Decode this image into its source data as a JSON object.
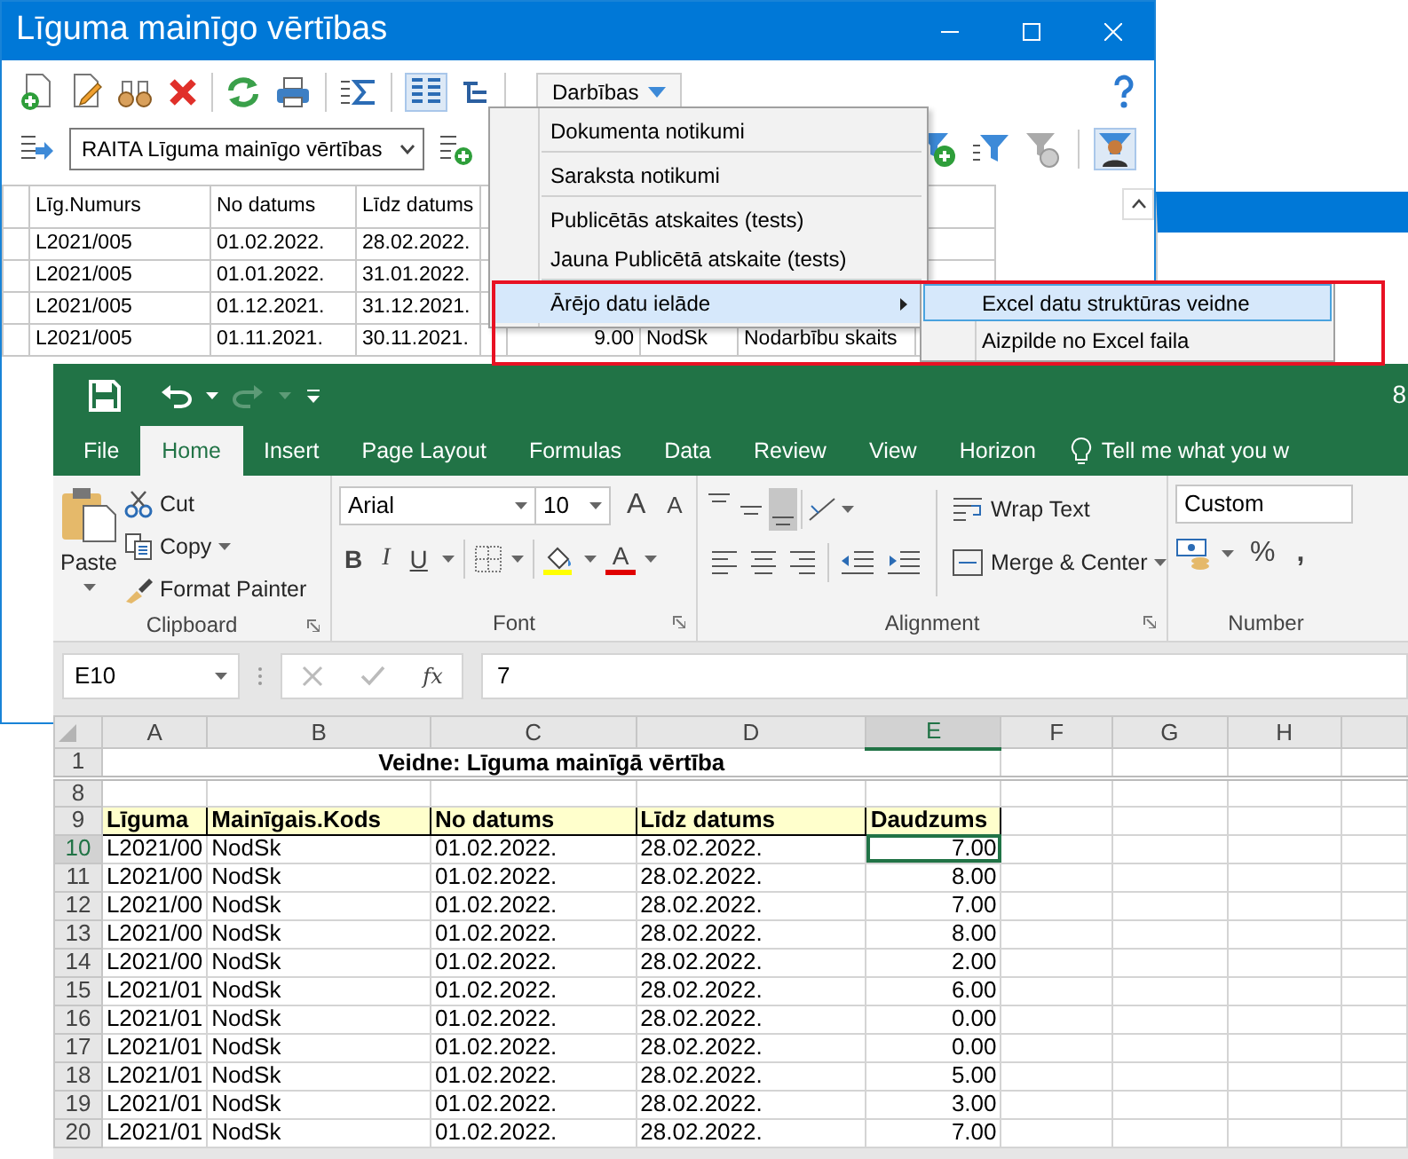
{
  "back_window": {
    "title": "Līguma mainīgo vērtības",
    "toolbar": {
      "actions_button": "Darbības",
      "columns_toggle_on": true
    },
    "view_selector": {
      "value": "RAITA Līguma mainīgo vērtības"
    },
    "grid": {
      "columns": [
        "Līg.Numurs",
        "No datums",
        "Līdz datums"
      ],
      "rows": [
        {
          "cells": [
            "L2021/005",
            "01.02.2022.",
            "28.02.2022."
          ]
        },
        {
          "cells": [
            "L2021/005",
            "01.01.2022.",
            "31.01.2022."
          ]
        },
        {
          "cells": [
            "L2021/005",
            "01.12.2021.",
            "31.12.2021."
          ]
        },
        {
          "cells": [
            "L2021/005",
            "01.11.2021.",
            "30.11.2021.",
            "9.00",
            "NodSk",
            "Nodarbību skaits"
          ]
        }
      ]
    }
  },
  "actions_menu": {
    "items": [
      {
        "label": "Dokumenta notikumi",
        "selected": false,
        "submenu": false,
        "separator_after": true
      },
      {
        "label": "Saraksta notikumi",
        "selected": false,
        "submenu": false,
        "separator_after": true
      },
      {
        "label": "Publicētās atskaites (tests)",
        "selected": false,
        "submenu": false,
        "separator_after": false
      },
      {
        "label": "Jauna Publicētā atskaite (tests)",
        "selected": false,
        "submenu": false,
        "separator_after": true
      },
      {
        "label": "Ārējo datu ielāde",
        "selected": true,
        "submenu": true,
        "separator_after": false
      }
    ],
    "submenu": [
      {
        "label": "Excel datu struktūras veidne",
        "selected": true
      },
      {
        "label": "Aizpilde no Excel faila",
        "selected": false
      }
    ]
  },
  "excel": {
    "title_fragment": "8",
    "tabs": [
      {
        "label": "File",
        "selected": false
      },
      {
        "label": "Home",
        "selected": true
      },
      {
        "label": "Insert",
        "selected": false
      },
      {
        "label": "Page Layout",
        "selected": false
      },
      {
        "label": "Formulas",
        "selected": false
      },
      {
        "label": "Data",
        "selected": false
      },
      {
        "label": "Review",
        "selected": false
      },
      {
        "label": "View",
        "selected": false
      },
      {
        "label": "Horizon",
        "selected": false
      }
    ],
    "tell_me": "Tell me what you w",
    "clipboard": {
      "paste": "Paste",
      "cut": "Cut",
      "copy": "Copy",
      "format_painter": "Format Painter",
      "label": "Clipboard"
    },
    "font": {
      "name": "Arial",
      "size": "10",
      "grow": "A",
      "shrink": "A",
      "bold": "B",
      "italic": "I",
      "underline": "U",
      "color_button": "A",
      "label": "Font"
    },
    "alignment": {
      "vertical": [
        {
          "selected": false
        },
        {
          "selected": false
        },
        {
          "selected": true
        }
      ],
      "wrap": "Wrap Text",
      "merge": "Merge & Center",
      "label": "Alignment"
    },
    "number": {
      "format": "Custom",
      "percent": "%",
      "comma": ",",
      "label": "Number"
    },
    "name_box": "E10",
    "fx": "fx",
    "formula": "7",
    "columns": [
      {
        "label": "A",
        "selected": false
      },
      {
        "label": "B",
        "selected": false
      },
      {
        "label": "C",
        "selected": false
      },
      {
        "label": "D",
        "selected": false
      },
      {
        "label": "E",
        "selected": true
      },
      {
        "label": "F",
        "selected": false
      },
      {
        "label": "G",
        "selected": false
      },
      {
        "label": "H",
        "selected": false
      }
    ],
    "rows": [
      {
        "header": "1",
        "selected": false,
        "kind": "title",
        "cells": [
          "Veidne: Līguma mainīgā vērtība"
        ]
      },
      {
        "header": "8",
        "selected": false,
        "kind": "blank"
      },
      {
        "header": "9",
        "selected": false,
        "kind": "head",
        "cells": [
          "Līguma",
          "Mainīgais.Kods",
          "No datums",
          "Līdz datums",
          "Daudzums"
        ]
      },
      {
        "header": "10",
        "selected": true,
        "kind": "data",
        "cells": [
          "L2021/00",
          "NodSk",
          "01.02.2022.",
          "28.02.2022.",
          "7.00"
        ]
      },
      {
        "header": "11",
        "selected": false,
        "kind": "data",
        "cells": [
          "L2021/00",
          "NodSk",
          "01.02.2022.",
          "28.02.2022.",
          "8.00"
        ]
      },
      {
        "header": "12",
        "selected": false,
        "kind": "data",
        "cells": [
          "L2021/00",
          "NodSk",
          "01.02.2022.",
          "28.02.2022.",
          "7.00"
        ]
      },
      {
        "header": "13",
        "selected": false,
        "kind": "data",
        "cells": [
          "L2021/00",
          "NodSk",
          "01.02.2022.",
          "28.02.2022.",
          "8.00"
        ]
      },
      {
        "header": "14",
        "selected": false,
        "kind": "data",
        "cells": [
          "L2021/00",
          "NodSk",
          "01.02.2022.",
          "28.02.2022.",
          "2.00"
        ]
      },
      {
        "header": "15",
        "selected": false,
        "kind": "data",
        "cells": [
          "L2021/01",
          "NodSk",
          "01.02.2022.",
          "28.02.2022.",
          "6.00"
        ]
      },
      {
        "header": "16",
        "selected": false,
        "kind": "data",
        "cells": [
          "L2021/01",
          "NodSk",
          "01.02.2022.",
          "28.02.2022.",
          "0.00"
        ]
      },
      {
        "header": "17",
        "selected": false,
        "kind": "data",
        "cells": [
          "L2021/01",
          "NodSk",
          "01.02.2022.",
          "28.02.2022.",
          "0.00"
        ]
      },
      {
        "header": "18",
        "selected": false,
        "kind": "data",
        "cells": [
          "L2021/01",
          "NodSk",
          "01.02.2022.",
          "28.02.2022.",
          "5.00"
        ]
      },
      {
        "header": "19",
        "selected": false,
        "kind": "data",
        "cells": [
          "L2021/01",
          "NodSk",
          "01.02.2022.",
          "28.02.2022.",
          "3.00"
        ]
      },
      {
        "header": "20",
        "selected": false,
        "kind": "data",
        "cells": [
          "L2021/01",
          "NodSk",
          "01.02.2022.",
          "28.02.2022.",
          "7.00"
        ]
      }
    ]
  }
}
